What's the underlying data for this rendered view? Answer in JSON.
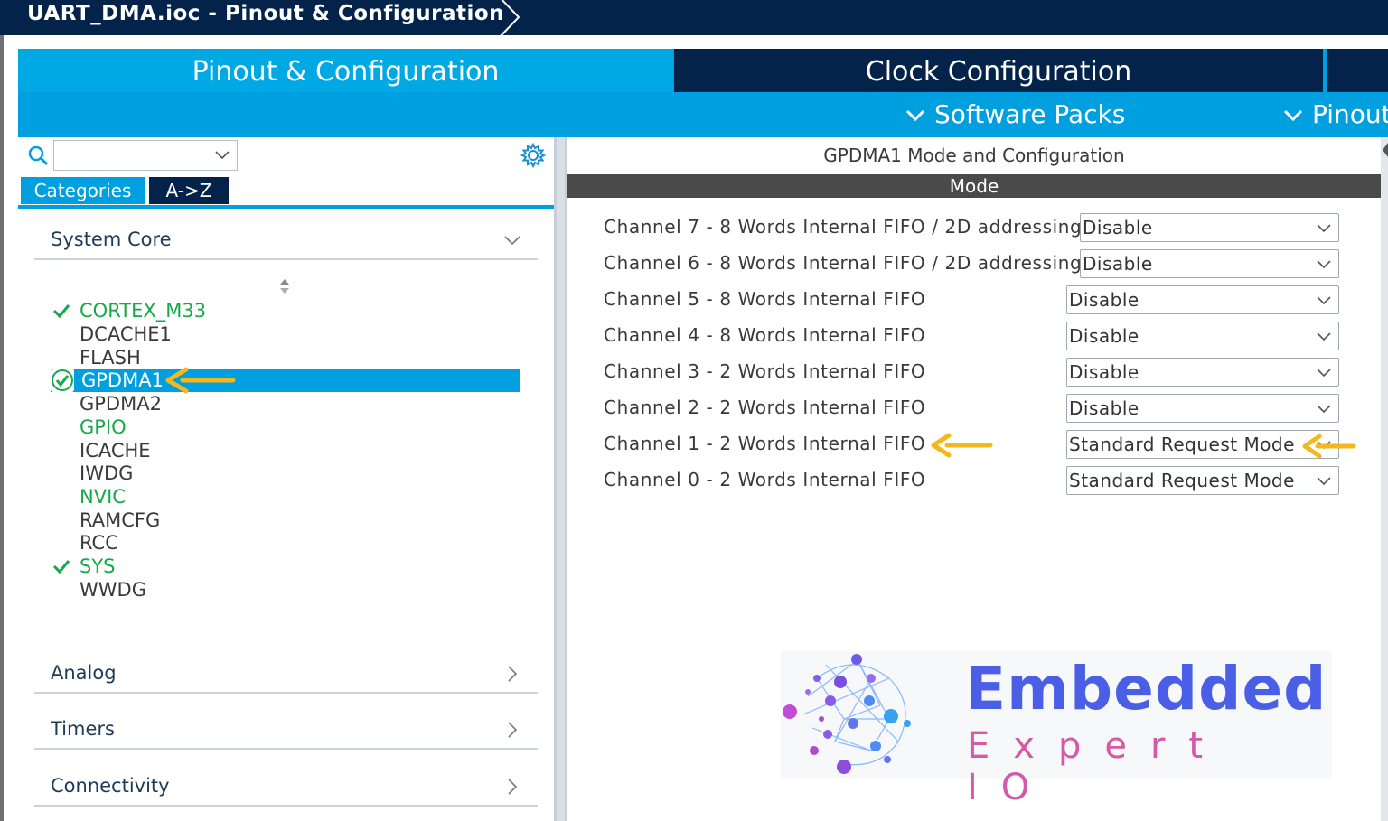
{
  "window": {
    "breadcrumb": "UART_DMA.ioc - Pinout & Configuration"
  },
  "tabs": {
    "pinout": "Pinout & Configuration",
    "clock": "Clock Configuration"
  },
  "subtabs": {
    "software_packs": "Software Packs",
    "pinout": "Pinout"
  },
  "left": {
    "view_buttons": {
      "categories": "Categories",
      "az": "A->Z"
    },
    "search": {
      "value": ""
    },
    "categories": [
      {
        "label": "System Core",
        "expanded": true
      },
      {
        "label": "Analog",
        "expanded": false
      },
      {
        "label": "Timers",
        "expanded": false
      },
      {
        "label": "Connectivity",
        "expanded": false
      }
    ],
    "peripherals": [
      {
        "name": "CORTEX_M33",
        "status": "configured"
      },
      {
        "name": "DCACHE1",
        "status": "none"
      },
      {
        "name": "FLASH",
        "status": "none"
      },
      {
        "name": "GPDMA1",
        "status": "selected"
      },
      {
        "name": "GPDMA2",
        "status": "none"
      },
      {
        "name": "GPIO",
        "status": "available"
      },
      {
        "name": "ICACHE",
        "status": "none"
      },
      {
        "name": "IWDG",
        "status": "none"
      },
      {
        "name": "NVIC",
        "status": "available"
      },
      {
        "name": "RAMCFG",
        "status": "none"
      },
      {
        "name": "RCC",
        "status": "none"
      },
      {
        "name": "SYS",
        "status": "configured"
      },
      {
        "name": "WWDG",
        "status": "none"
      }
    ]
  },
  "right": {
    "title": "GPDMA1 Mode and Configuration",
    "mode_header": "Mode",
    "channels": [
      {
        "label": "Channel 7  - 8 Words Internal FIFO / 2D addressing",
        "value": "Disable"
      },
      {
        "label": "Channel 6  - 8 Words Internal FIFO / 2D addressing",
        "value": "Disable"
      },
      {
        "label": "Channel 5  - 8 Words Internal FIFO",
        "value": "Disable"
      },
      {
        "label": "Channel 4  - 8 Words Internal FIFO",
        "value": "Disable"
      },
      {
        "label": "Channel 3  - 2 Words Internal FIFO",
        "value": "Disable"
      },
      {
        "label": "Channel 2  - 2 Words Internal FIFO",
        "value": "Disable"
      },
      {
        "label": "Channel 1  - 2 Words Internal FIFO",
        "value": "Standard Request Mode"
      },
      {
        "label": "Channel 0  - 2 Words Internal FIFO",
        "value": "Standard Request Mode"
      }
    ]
  },
  "logo": {
    "line1": "Embedded",
    "line2": "Expert IO"
  },
  "colors": {
    "navy": "#03234b",
    "st_blue": "#00a0e0",
    "green": "#18a84a",
    "arrow": "#f5b81c"
  }
}
